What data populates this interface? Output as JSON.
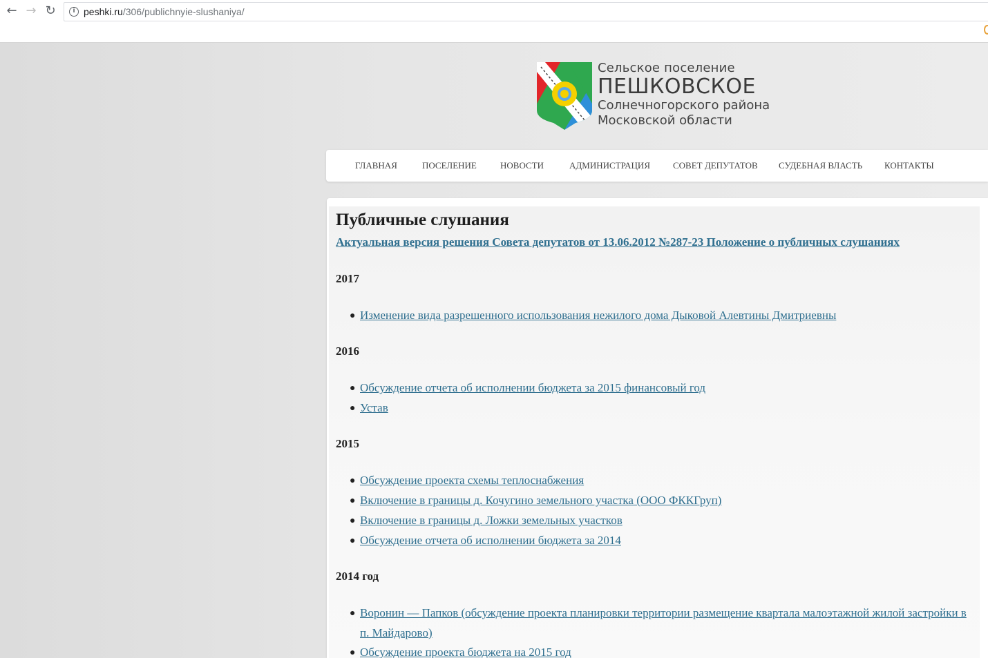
{
  "browser": {
    "url_host": "peshki.ru",
    "url_path": "/306/publichnyie-slushaniya/"
  },
  "logo": {
    "line1": "Сельское поселение",
    "line2": "ПЕШКОВСКОЕ",
    "line3": "Солнечногорского района",
    "line4": "Московской области"
  },
  "menu": [
    {
      "label": "ГЛАВНАЯ"
    },
    {
      "label": "ПОСЕЛЕНИЕ"
    },
    {
      "label": "НОВОСТИ"
    },
    {
      "label": "АДМИНИСТРАЦИЯ"
    },
    {
      "label": "СОВЕТ ДЕПУТАТОВ"
    },
    {
      "label": "СУДЕБНАЯ ВЛАСТЬ"
    },
    {
      "label": "КОНТАКТЫ"
    }
  ],
  "content": {
    "title": "Публичные слушания",
    "main_link": "Актуальная версия решения Совета депутатов от 13.06.2012 №287-23 Положение о публичных слушаниях",
    "sections": [
      {
        "year": "2017",
        "items": [
          "Изменение вида разрешенного использования нежилого дома Дыковой Алевтины Дмитриевны"
        ]
      },
      {
        "year": "2016",
        "items": [
          "Обсуждение отчета об исполнении бюджета за 2015 финансовый год",
          "Устав"
        ]
      },
      {
        "year": "2015",
        "items": [
          "Обсуждение проекта схемы теплоснабжения",
          "Включение в границы д. Кочугино земельного участка (ООО ФККГруп)",
          "Включение в границы д. Ложки земельных участков",
          "Обсуждение отчета об исполнении бюджета за 2014"
        ]
      },
      {
        "year": "2014 год",
        "items": [
          "Воронин — Папков (обсуждение проекта планировки территории размещение квартала малоэтажной жилой застройки в",
          "п. Майдарово)",
          "Обсуждение проекта бюджета на 2015 год"
        ]
      }
    ]
  }
}
